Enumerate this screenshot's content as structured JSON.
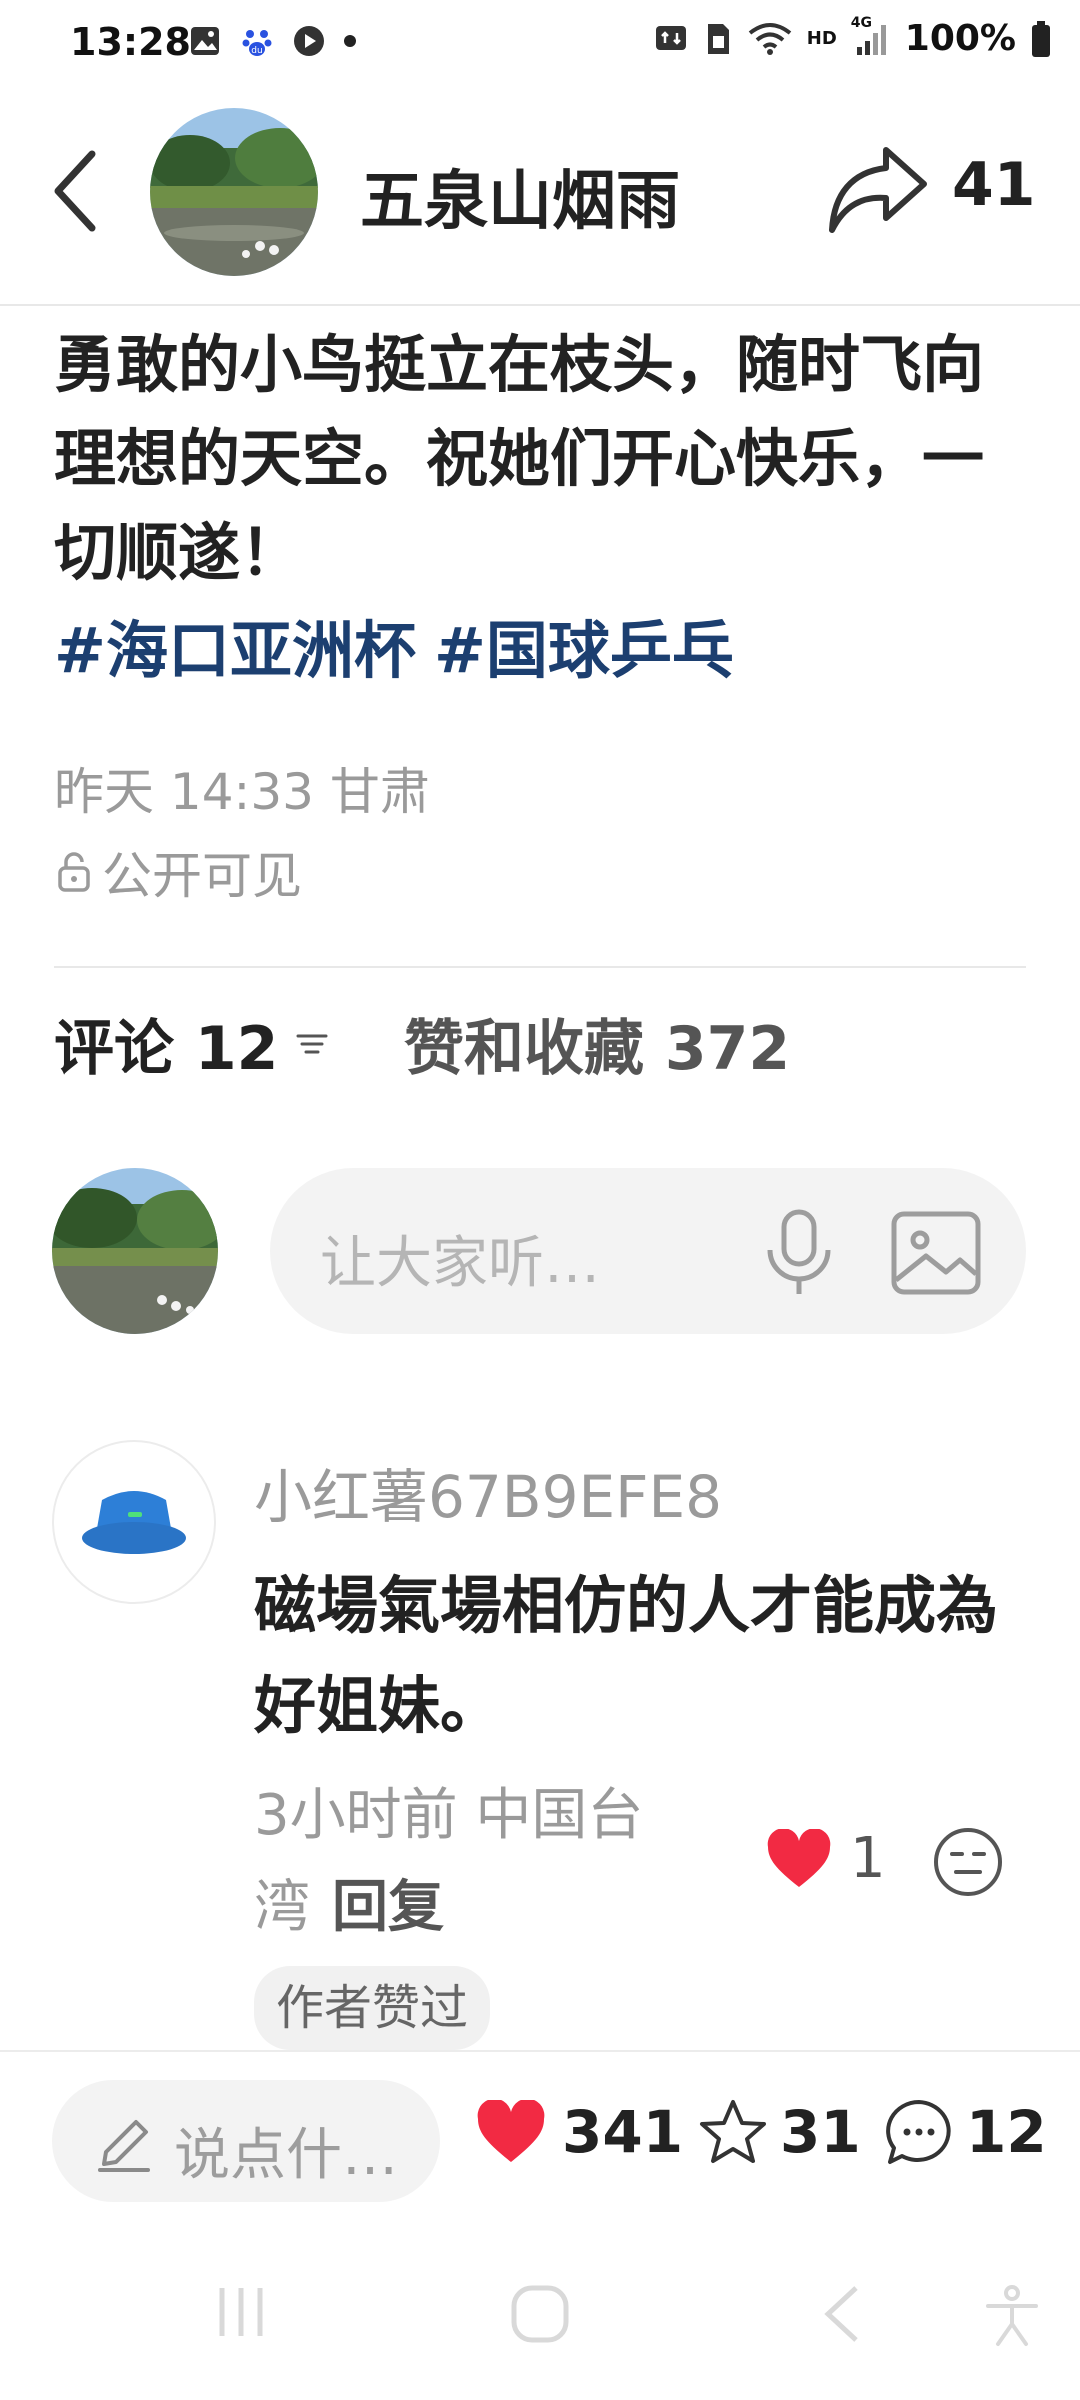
{
  "status_bar": {
    "time": "13:28",
    "network": "HD",
    "signal_label": "4G",
    "battery": "100%"
  },
  "header": {
    "username": "五泉山烟雨",
    "share_count": "41"
  },
  "post": {
    "text": "勇敢的小鸟挺立在枝头，随时飞向理想的天空。祝她们开心快乐，一切顺遂！",
    "tags": [
      "#海口亚洲杯",
      "#国球乒乓"
    ],
    "time_location": "昨天 14:33 甘肃",
    "visibility": "公开可见"
  },
  "tabs": {
    "comments_label": "评论 12",
    "likes_label": "赞和收藏 372"
  },
  "comment_input": {
    "placeholder": "让大家听…"
  },
  "comments": [
    {
      "author": "小红薯67B9EFE8",
      "text": "磁場氣場相仿的人才能成為好姐妹。",
      "meta": "3小时前 中国台湾",
      "reply_label": "回复",
      "likes": "1",
      "badge": "作者赞过"
    }
  ],
  "bottom_bar": {
    "say_placeholder": "说点什…",
    "likes": "341",
    "favorites": "31",
    "comments": "12"
  },
  "colors": {
    "hashtag": "#1c3f70",
    "like_red": "#f22a43",
    "muted_text": "#9a9a9a"
  },
  "icons": [
    "back-icon",
    "share-icon",
    "lock-icon",
    "sort-icon",
    "mic-icon",
    "image-icon",
    "heart-icon",
    "emoji-icon",
    "pencil-icon",
    "star-icon",
    "comment-icon"
  ]
}
